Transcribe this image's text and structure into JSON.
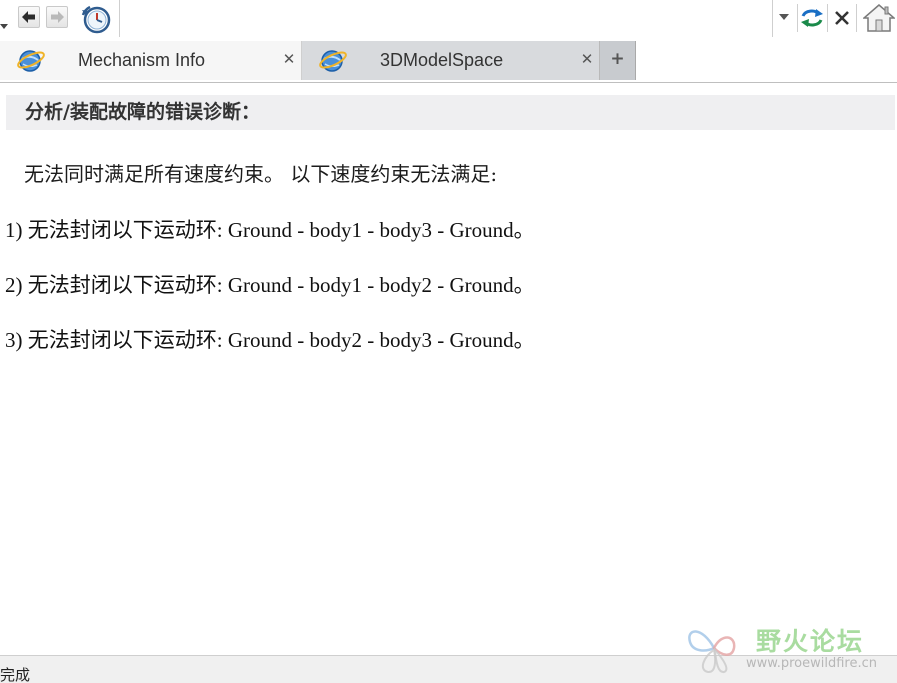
{
  "toolbar": {
    "address_value": "",
    "icons": {
      "back": "back-arrow-icon",
      "forward": "forward-arrow-icon",
      "history": "history-clock-icon",
      "refresh": "refresh-icon",
      "stop": "stop-x-icon",
      "home": "home-icon"
    }
  },
  "tabs": [
    {
      "label": "Mechanism Info",
      "close": "✕",
      "active": true,
      "icon": "ie-globe-icon"
    },
    {
      "label": "3DModelSpace",
      "close": "✕",
      "active": false,
      "icon": "ie-globe-icon"
    }
  ],
  "new_tab_label": "+",
  "content": {
    "header": "分析/装配故障的错误诊断：",
    "intro": "无法同时满足所有速度约束。 以下速度约束无法满足:",
    "loops": [
      "1) 无法封闭以下运动环: Ground - body1 - body3 - Ground。",
      "2) 无法封闭以下运动环: Ground - body1 - body2 - Ground。",
      "3) 无法封闭以下运动环: Ground - body2 - body3 - Ground。"
    ]
  },
  "status": {
    "text": "完成"
  },
  "watermark": {
    "title": "野火论坛",
    "url": "www.proewildfire.cn"
  },
  "colors": {
    "header_bg": "#efeff1",
    "active_tab_bg": "#f6f6f6",
    "inactive_tab_bg": "#d8dadd",
    "refresh_blue": "#1a6fc4",
    "watermark_green": "#a9dca0"
  }
}
